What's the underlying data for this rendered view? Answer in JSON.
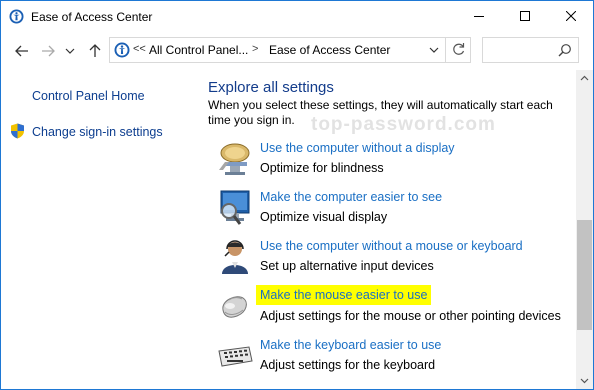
{
  "window": {
    "title": "Ease of Access Center",
    "icon": "ease-of-access-icon",
    "controls": [
      "minimize-icon",
      "maximize-icon",
      "close-icon"
    ]
  },
  "navigation": {
    "back_icon": "arrow-left-icon",
    "forward_icon": "arrow-right-icon",
    "recent_icon": "chevron-down-icon",
    "up_icon": "arrow-up-icon"
  },
  "address": {
    "overflow": "<<",
    "crumb1": "All Control Panel...",
    "separator": ">",
    "crumb2": "Ease of Access Center",
    "refresh_icon": "refresh-icon"
  },
  "search": {
    "placeholder": "",
    "icon": "search-icon"
  },
  "sidebar": {
    "home_label": "Control Panel Home",
    "signin_label": "Change sign-in settings"
  },
  "main": {
    "heading": "Explore all settings",
    "description": "When you select these settings, they will automatically start each time you sign in.",
    "watermark": "top-password.com",
    "items": [
      {
        "link": "Use the computer without a display",
        "sub": "Optimize for blindness",
        "icon": "display-speech-icon"
      },
      {
        "link": "Make the computer easier to see",
        "sub": "Optimize visual display",
        "icon": "magnifier-monitor-icon"
      },
      {
        "link": "Use the computer without a mouse or keyboard",
        "sub": "Set up alternative input devices",
        "icon": "person-headset-icon"
      },
      {
        "link": "Make the mouse easier to use",
        "sub": "Adjust settings for the mouse or other pointing devices",
        "icon": "mouse-icon",
        "highlighted": true
      },
      {
        "link": "Make the keyboard easier to use",
        "sub": "Adjust settings for the keyboard",
        "icon": "keyboard-icon"
      }
    ]
  },
  "colors": {
    "window_border": "#1e78d4",
    "link": "#1a6fc4",
    "heading": "#133c8b",
    "highlight": "#ffff00"
  }
}
